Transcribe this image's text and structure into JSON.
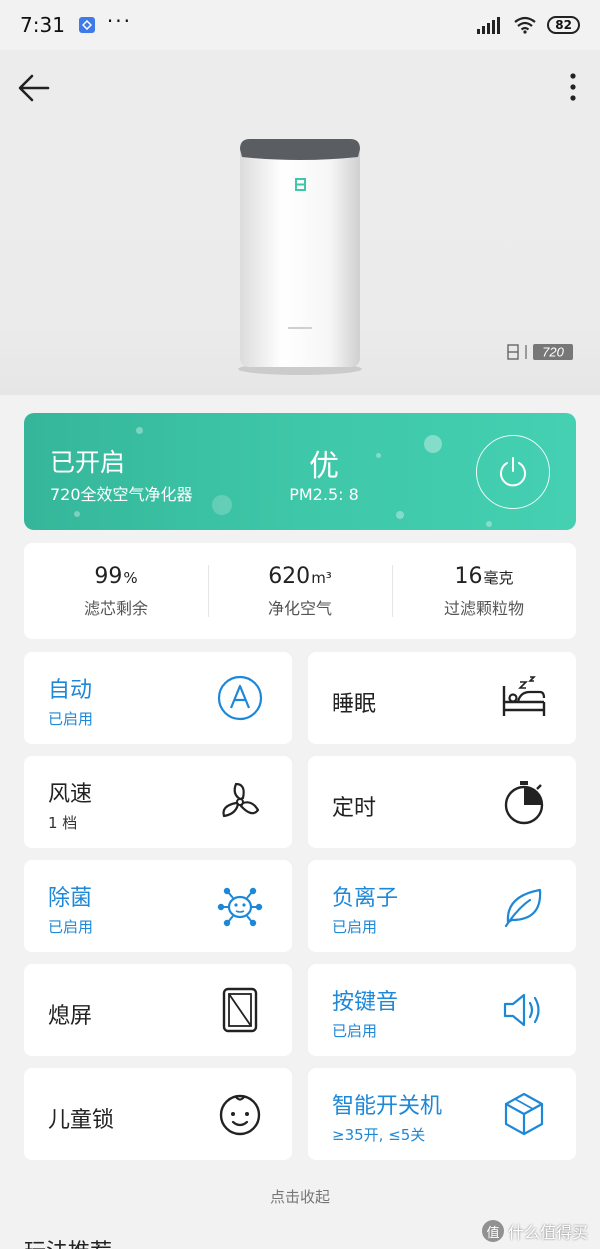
{
  "status_bar": {
    "time": "7:31",
    "dots": "···",
    "battery": "82"
  },
  "device": {
    "power_state": "已开启",
    "name": "720全效空气净化器",
    "air_quality": "优",
    "pm25": "PM2.5: 8",
    "brand_badge": "720",
    "accent_color": "#3ec7a8"
  },
  "stats": [
    {
      "value": "99",
      "unit": "%",
      "label": "滤芯剩余"
    },
    {
      "value": "620",
      "unit": "m³",
      "label": "净化空气"
    },
    {
      "value": "16",
      "unit": "毫克",
      "label": "过滤颗粒物"
    }
  ],
  "tiles": {
    "auto": {
      "title": "自动",
      "sub": "已启用",
      "icon": "auto-a-icon"
    },
    "sleep": {
      "title": "睡眠",
      "icon": "sleep-bed-icon"
    },
    "fan": {
      "title": "风速",
      "sub": "1 档",
      "icon": "fan-icon"
    },
    "timer": {
      "title": "定时",
      "icon": "stopwatch-icon"
    },
    "sterilize": {
      "title": "除菌",
      "sub": "已启用",
      "icon": "virus-icon"
    },
    "anion": {
      "title": "负离子",
      "sub": "已启用",
      "icon": "leaf-icon"
    },
    "screen_off": {
      "title": "熄屏",
      "icon": "screen-off-icon"
    },
    "key_sound": {
      "title": "按键音",
      "sub": "已启用",
      "icon": "speaker-icon"
    },
    "child_lock": {
      "title": "儿童锁",
      "icon": "baby-face-icon"
    },
    "smart_switch": {
      "title": "智能开关机",
      "sub": "≥35开, ≤5关",
      "icon": "cube-icon"
    }
  },
  "collapse_label": "点击收起",
  "section_heading": "玩法推荐",
  "watermark": {
    "logo": "值",
    "text": "什么值得买"
  },
  "colors": {
    "active_blue": "#1e88d8",
    "background": "#f2f2f2"
  }
}
